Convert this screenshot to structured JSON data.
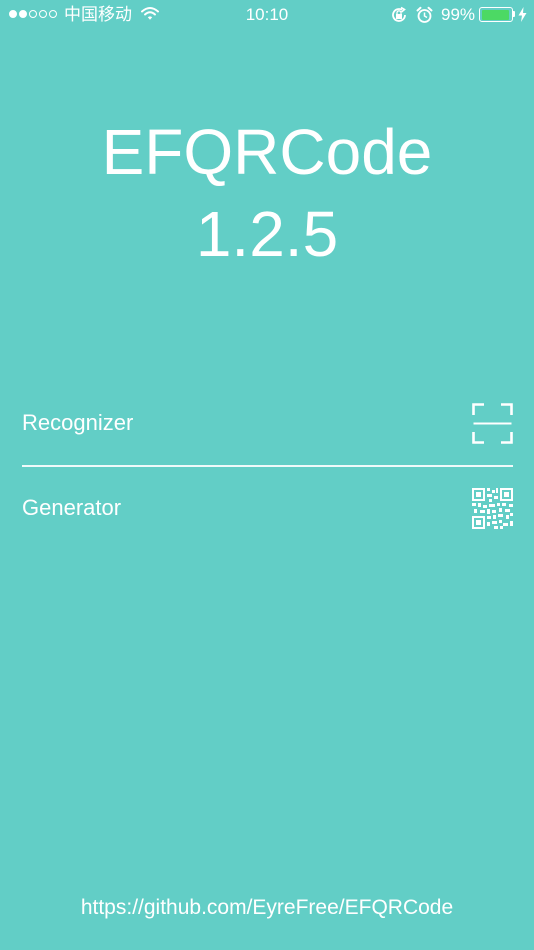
{
  "status_bar": {
    "signal_bars_filled": 2,
    "signal_bars_total": 5,
    "carrier": "中国移动",
    "time": "10:10",
    "battery_percent": "99%",
    "battery_level": 0.99,
    "battery_fill_color": "#4cd964",
    "icons": [
      "wifi-icon",
      "rotation-lock-icon",
      "alarm-icon",
      "battery-icon",
      "charging-bolt-icon"
    ]
  },
  "app": {
    "title": "EFQRCode",
    "version": "1.2.5",
    "background_color": "#62cec6"
  },
  "menu": {
    "recognizer": {
      "label": "Recognizer",
      "icon": "scan-frame-icon"
    },
    "generator": {
      "label": "Generator",
      "icon": "qr-code-icon"
    }
  },
  "footer": {
    "link": "https://github.com/EyreFree/EFQRCode"
  }
}
